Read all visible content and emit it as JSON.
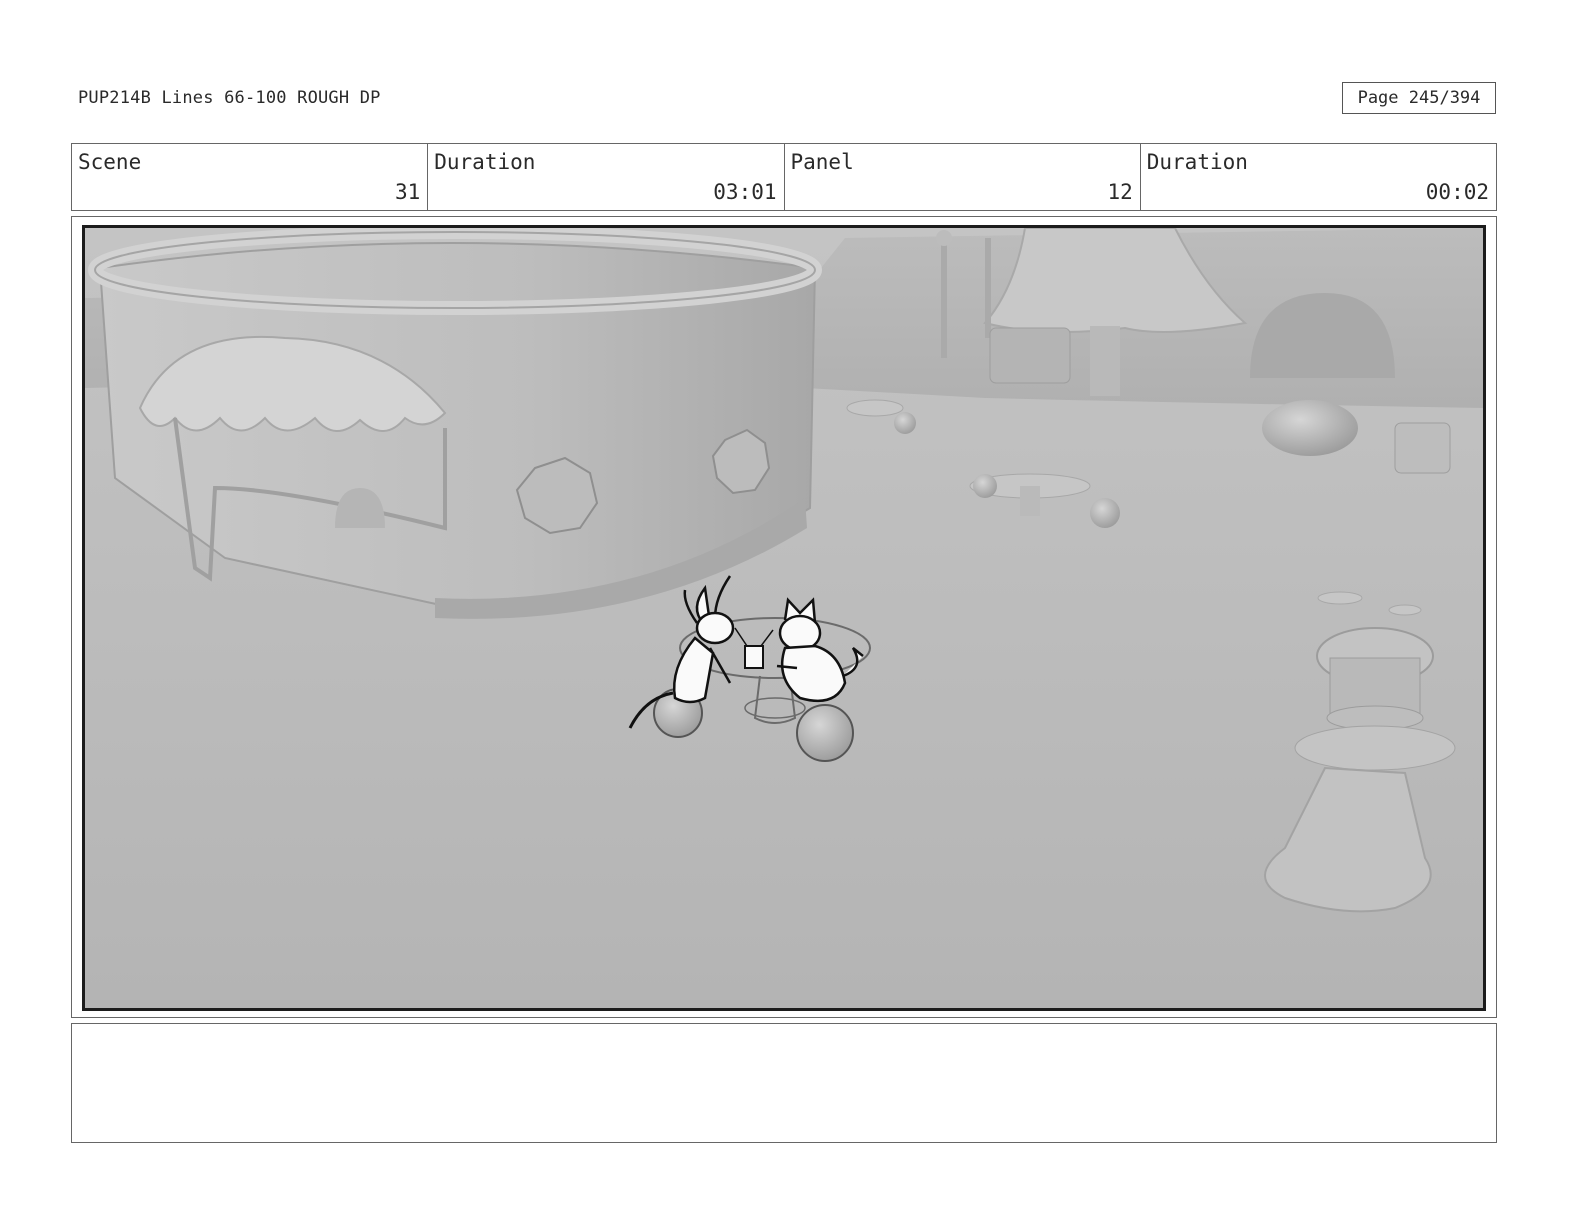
{
  "header": {
    "title": "PUP214B Lines 66-100 ROUGH DP",
    "page": "Page 245/394"
  },
  "info": {
    "scene_label": "Scene",
    "scene_value": "31",
    "duration_label": "Duration",
    "duration_value": "03:01",
    "panel_label": "Panel",
    "panel_value": "12",
    "panel_duration_label": "Duration",
    "panel_duration_value": "00:02"
  },
  "notes": {
    "text": ""
  }
}
